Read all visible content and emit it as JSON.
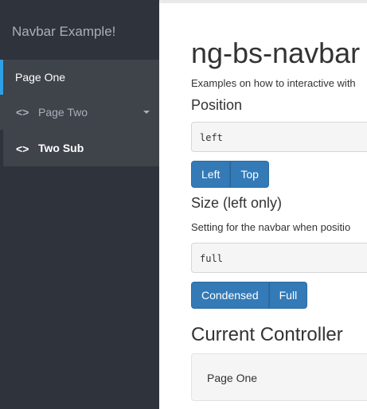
{
  "sidebar": {
    "brand": "Navbar Example!",
    "items": [
      {
        "label": "Page One"
      },
      {
        "icon": "<>",
        "label": "Page Two"
      },
      {
        "icon": "<>",
        "label": "Two Sub"
      }
    ]
  },
  "main": {
    "title": "ng-bs-navbar",
    "intro": "Examples on how to interactive with",
    "position": {
      "heading": "Position",
      "value": "left",
      "buttons": [
        "Left",
        "Top"
      ]
    },
    "size": {
      "heading": "Size (left only)",
      "help": "Setting for the navbar when positio",
      "value": "full",
      "buttons": [
        "Condensed",
        "Full"
      ]
    },
    "controller": {
      "heading": "Current Controller",
      "value": "Page One"
    }
  },
  "colors": {
    "sidebar_bg": "#2f333b",
    "nav_item_bg": "#3f434a",
    "active_accent": "#2ea0e6",
    "button_primary": "#337ab7"
  },
  "icons": [
    "code-icon",
    "caret-down-icon"
  ]
}
